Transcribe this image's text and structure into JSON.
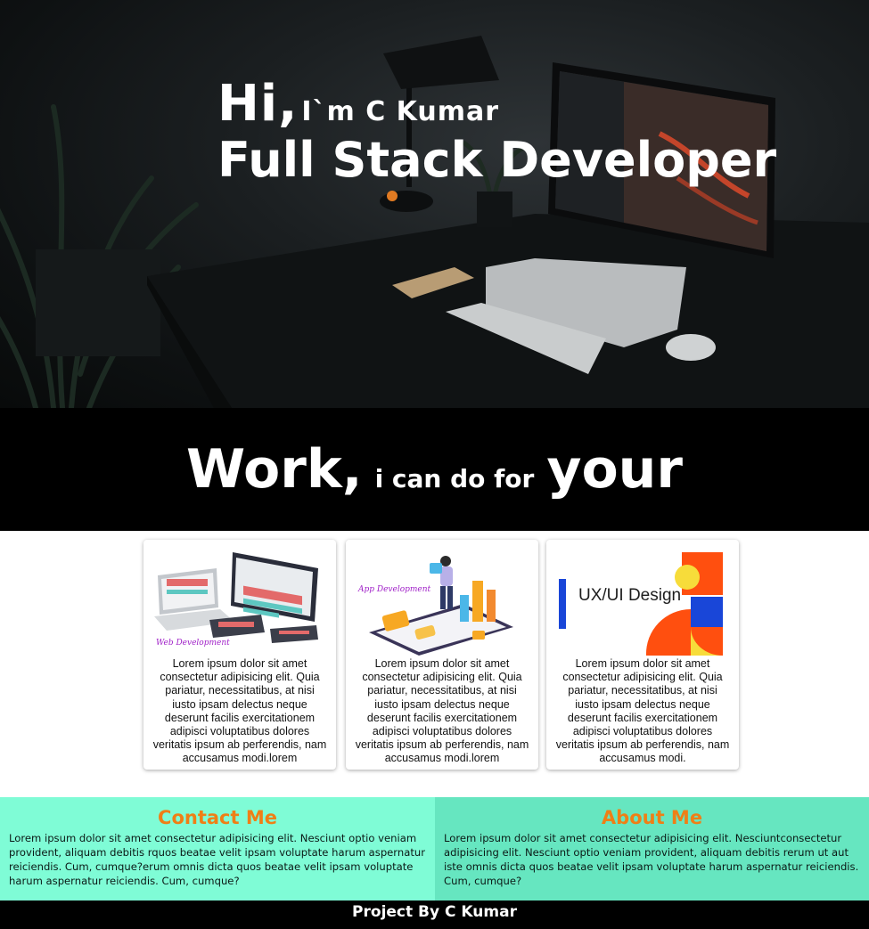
{
  "hero": {
    "hi": "Hi,",
    "name": "I`m C Kumar",
    "role": "Full Stack Developer"
  },
  "work_banner": {
    "word1": "Work,",
    "middle": "i can do for",
    "word2": "your"
  },
  "cards": [
    {
      "image_label": "Web Development",
      "image_icon": "web-development-illustration",
      "text": "Lorem ipsum dolor sit amet consectetur adipisicing elit. Quia pariatur, necessitatibus, at nisi iusto ipsam delectus neque deserunt facilis exercitationem adipisci voluptatibus dolores veritatis ipsum ab perferendis, nam accusamus modi.lorem"
    },
    {
      "image_label": "App Development",
      "image_icon": "app-development-illustration",
      "text": "Lorem ipsum dolor sit amet consectetur adipisicing elit. Quia pariatur, necessitatibus, at nisi iusto ipsam delectus neque deserunt facilis exercitationem adipisci voluptatibus dolores veritatis ipsum ab perferendis, nam accusamus modi.lorem"
    },
    {
      "image_label": "UX/UI Design",
      "image_icon": "ux-ui-design-illustration",
      "text": "Lorem ipsum dolor sit amet consectetur adipisicing elit. Quia pariatur, necessitatibus, at nisi iusto ipsam delectus neque deserunt facilis exercitationem adipisci voluptatibus dolores veritatis ipsum ab perferendis, nam accusamus modi."
    }
  ],
  "contact": {
    "title": "Contact Me",
    "text": "Lorem ipsum dolor sit amet consectetur adipisicing elit. Nesciunt optio veniam provident, aliquam debitis rquos beatae velit ipsam voluptate harum aspernatur reiciendis. Cum, cumque?erum omnis dicta quos beatae velit ipsam voluptate harum aspernatur reiciendis. Cum, cumque?"
  },
  "about": {
    "title": "About Me",
    "text": "Lorem ipsum dolor sit amet consectetur adipisicing elit. Nesciuntconsectetur adipisicing elit. Nesciunt optio veniam provident, aliquam debitis rerum ut aut iste omnis dicta quos beatae velit ipsam voluptate harum aspernatur reiciendis. Cum, cumque?"
  },
  "footer": {
    "text": "Project By C Kumar"
  },
  "colors": {
    "accent_orange": "#ef7f16",
    "contact_bg": "#7ffcd6",
    "about_bg": "#66e6c0",
    "banner_bg": "#000000"
  }
}
